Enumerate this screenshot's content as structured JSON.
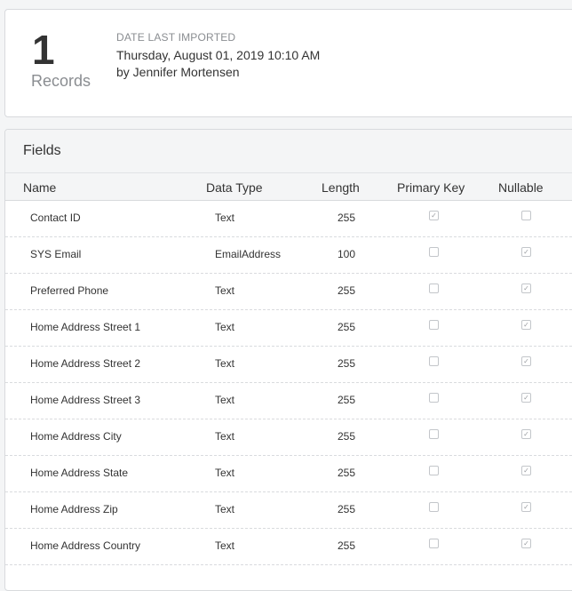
{
  "summary": {
    "record_count": "1",
    "record_label": "Records",
    "import_caption": "DATE LAST IMPORTED",
    "import_date": "Thursday, August 01, 2019 10:10 AM",
    "import_by": "by Jennifer Mortensen"
  },
  "fields": {
    "title": "Fields",
    "columns": {
      "name": "Name",
      "data_type": "Data Type",
      "length": "Length",
      "primary_key": "Primary Key",
      "nullable": "Nullable"
    },
    "rows": [
      {
        "name": "Contact ID",
        "type": "Text",
        "length": "255",
        "primary_key": true,
        "nullable": false
      },
      {
        "name": "SYS Email",
        "type": "EmailAddress",
        "length": "100",
        "primary_key": false,
        "nullable": true
      },
      {
        "name": "Preferred Phone",
        "type": "Text",
        "length": "255",
        "primary_key": false,
        "nullable": true
      },
      {
        "name": "Home Address Street 1",
        "type": "Text",
        "length": "255",
        "primary_key": false,
        "nullable": true
      },
      {
        "name": "Home Address Street 2",
        "type": "Text",
        "length": "255",
        "primary_key": false,
        "nullable": true
      },
      {
        "name": "Home Address Street 3",
        "type": "Text",
        "length": "255",
        "primary_key": false,
        "nullable": true
      },
      {
        "name": "Home Address City",
        "type": "Text",
        "length": "255",
        "primary_key": false,
        "nullable": true
      },
      {
        "name": "Home Address State",
        "type": "Text",
        "length": "255",
        "primary_key": false,
        "nullable": true
      },
      {
        "name": "Home Address Zip",
        "type": "Text",
        "length": "255",
        "primary_key": false,
        "nullable": true
      },
      {
        "name": "Home Address Country",
        "type": "Text",
        "length": "255",
        "primary_key": false,
        "nullable": true
      }
    ]
  }
}
